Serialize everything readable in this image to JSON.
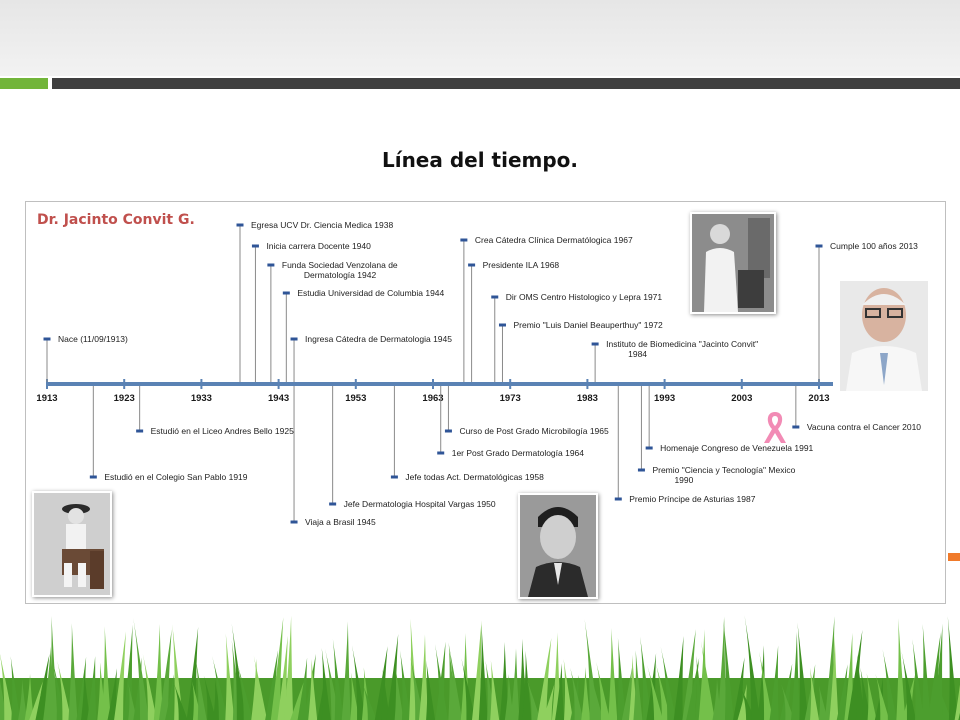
{
  "slide": {
    "title": "Línea del tiempo."
  },
  "panel": {
    "title": "Dr. Jacinto Convit  G."
  },
  "colors": {
    "title_red": "#c0504d",
    "axis_blue": "#5a82b4",
    "marker_blue": "#2f5597",
    "grass_green": "#5aa93a"
  },
  "axis": {
    "years": [
      "1913",
      "1923",
      "1933",
      "1943",
      "1953",
      "1963",
      "1973",
      "1983",
      "1993",
      "2003",
      "2013"
    ]
  },
  "events_above": [
    {
      "year": 1913.0,
      "label": "Nace (11/09/1913)"
    },
    {
      "year": 1938.0,
      "label": "Egresa UCV Dr. Ciencia Medica 1938"
    },
    {
      "year": 1940.0,
      "label": "Inicia  carrera Docente 1940"
    },
    {
      "year": 1942.0,
      "label": "Funda Sociedad Venzolana de\nDermatología 1942"
    },
    {
      "year": 1944.0,
      "label": "Estudia Universidad de Columbia 1944"
    },
    {
      "year": 1945.0,
      "label": "Ingresa Cátedra de Dermatologia 1945"
    },
    {
      "year": 1967.0,
      "label": "Crea Cátedra Clínica  Dermatólogica 1967"
    },
    {
      "year": 1968.0,
      "label": "Presidente  ILA 1968"
    },
    {
      "year": 1971.0,
      "label": "Dir  OMS Centro Histologico  y Lepra 1971"
    },
    {
      "year": 1972.0,
      "label": "Premio \"Luis Daniel Beauperthuy\" 1972"
    },
    {
      "year": 1984.0,
      "label": "Instituto de Biomedicina  \"Jacinto Convit\"\n1984"
    },
    {
      "year": 2013.0,
      "label": "Cumple 100 años 2013"
    }
  ],
  "events_below": [
    {
      "year": 1919.0,
      "label": "Estudió en el Colegio San Pablo 1919"
    },
    {
      "year": 1925.0,
      "label": "Estudió en el Liceo Andres Bello 1925"
    },
    {
      "year": 1945.0,
      "label": "Viaja   a Brasil 1945"
    },
    {
      "year": 1950.0,
      "label": "Jefe Dermatologia Hospital Vargas 1950"
    },
    {
      "year": 1958.0,
      "label": "Jefe todas Act. Dermatológicas 1958"
    },
    {
      "year": 1964.0,
      "label": "1er Post Grado Dermatología 1964"
    },
    {
      "year": 1965.0,
      "label": "Curso de Post Grado Microbilogía  1965"
    },
    {
      "year": 1987.0,
      "label": "Premio Príncipe de Asturias 1987"
    },
    {
      "year": 1990.0,
      "label": "Premio \"Ciencia y Tecnología\" Mexico\n1990"
    },
    {
      "year": 1991.0,
      "label": "Homenaje Congreso de Venezuela 1991"
    },
    {
      "year": 2010.0,
      "label": "Vacuna contra el Cancer 2010"
    }
  ],
  "photos": [
    {
      "name": "photo-child",
      "description": "child"
    },
    {
      "name": "photo-young-man",
      "description": "young man"
    },
    {
      "name": "photo-lab",
      "description": "lab"
    },
    {
      "name": "photo-elderly",
      "description": "elderly"
    }
  ]
}
